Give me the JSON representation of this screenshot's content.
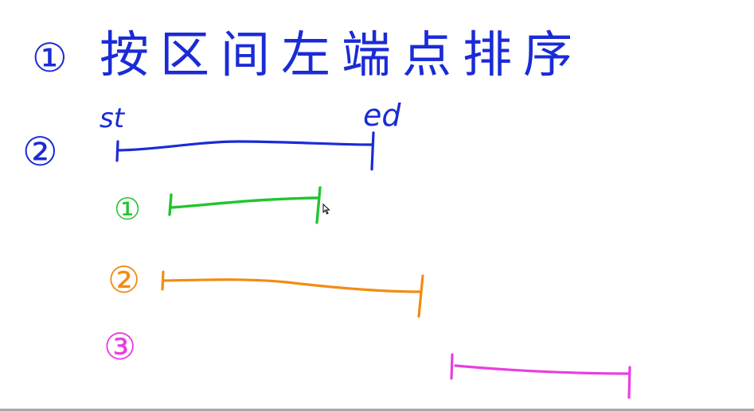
{
  "heading": {
    "marker": "①",
    "text": "按区间左端点排序"
  },
  "main_interval": {
    "marker": "②",
    "start_label": "st",
    "end_label": "ed"
  },
  "cases": [
    {
      "marker": "①",
      "color": "#22c431"
    },
    {
      "marker": "②",
      "color": "#f28c12"
    },
    {
      "marker": "③",
      "color": "#e83ee0"
    }
  ],
  "colors": {
    "blue_ink": "#1a2bd6",
    "green_ink": "#22c431",
    "orange_ink": "#f28c12",
    "magenta_ink": "#e83ee0",
    "background": "#ffffff"
  }
}
